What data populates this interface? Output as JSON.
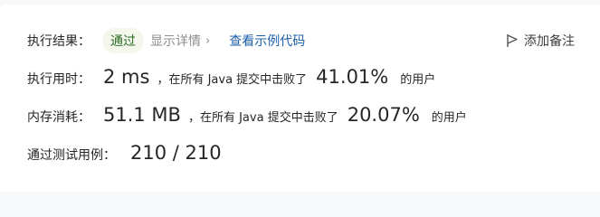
{
  "result": {
    "label": "执行结果：",
    "status": "通过",
    "detail_link": "显示详情",
    "detail_chevron": "›",
    "code_link": "查看示例代码",
    "note_link": "添加备注"
  },
  "time": {
    "label": "执行用时：",
    "value": "2 ms",
    "middle": "，在所有 Java 提交中击败了",
    "percent": "41.01%",
    "suffix": "的用户"
  },
  "memory": {
    "label": "内存消耗：",
    "value": "51.1 MB",
    "middle": "，在所有 Java 提交中击败了",
    "percent": "20.07%",
    "suffix": "的用户"
  },
  "tests": {
    "label": "通过测试用例：",
    "value": "210 / 210"
  }
}
